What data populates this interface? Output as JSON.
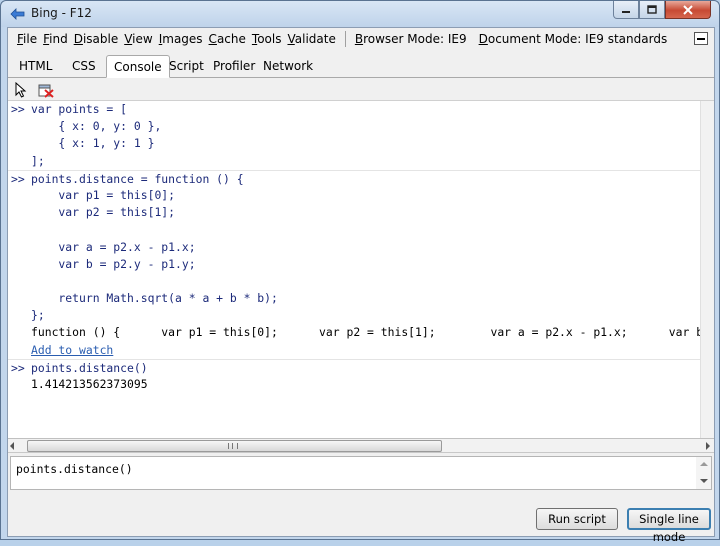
{
  "window": {
    "title": "Bing - F12"
  },
  "menubar": {
    "items": [
      "File",
      "Find",
      "Disable",
      "View",
      "Images",
      "Cache",
      "Tools",
      "Validate"
    ],
    "browser_mode": "Browser Mode: IE9",
    "document_mode": "Document Mode: IE9 standards"
  },
  "tabs": [
    "HTML",
    "CSS",
    "Console",
    "Script",
    "Profiler",
    "Network"
  ],
  "active_tab": "Console",
  "console": {
    "lines": [
      {
        "prompt": ">>",
        "text": "var points = [",
        "kind": "input"
      },
      {
        "prompt": "",
        "text": "    { x: 0, y: 0 },",
        "kind": "input"
      },
      {
        "prompt": "",
        "text": "    { x: 1, y: 1 }",
        "kind": "input"
      },
      {
        "prompt": "",
        "text": "];",
        "kind": "input"
      },
      {
        "prompt": ">>",
        "text": "points.distance = function () {",
        "kind": "input"
      },
      {
        "prompt": "",
        "text": "    var p1 = this[0];",
        "kind": "input"
      },
      {
        "prompt": "",
        "text": "    var p2 = this[1];",
        "kind": "input"
      },
      {
        "prompt": "",
        "text": "",
        "kind": "input"
      },
      {
        "prompt": "",
        "text": "    var a = p2.x - p1.x;",
        "kind": "input"
      },
      {
        "prompt": "",
        "text": "    var b = p2.y - p1.y;",
        "kind": "input"
      },
      {
        "prompt": "",
        "text": "",
        "kind": "input"
      },
      {
        "prompt": "",
        "text": "    return Math.sqrt(a * a + b * b);",
        "kind": "input"
      },
      {
        "prompt": "",
        "text": "};",
        "kind": "input"
      },
      {
        "prompt": "",
        "text": "function () {      var p1 = this[0];      var p2 = this[1];        var a = p2.x - p1.x;      var b",
        "kind": "output"
      },
      {
        "prompt": "",
        "text": "Add to watch",
        "kind": "link"
      },
      {
        "prompt": ">>",
        "text": "points.distance()",
        "kind": "input"
      },
      {
        "prompt": "",
        "text": "1.414213562373095",
        "kind": "output"
      }
    ]
  },
  "input": {
    "value": "points.distance()"
  },
  "buttons": {
    "run_script": "Run script",
    "single_line_mode": "Single line mode"
  }
}
